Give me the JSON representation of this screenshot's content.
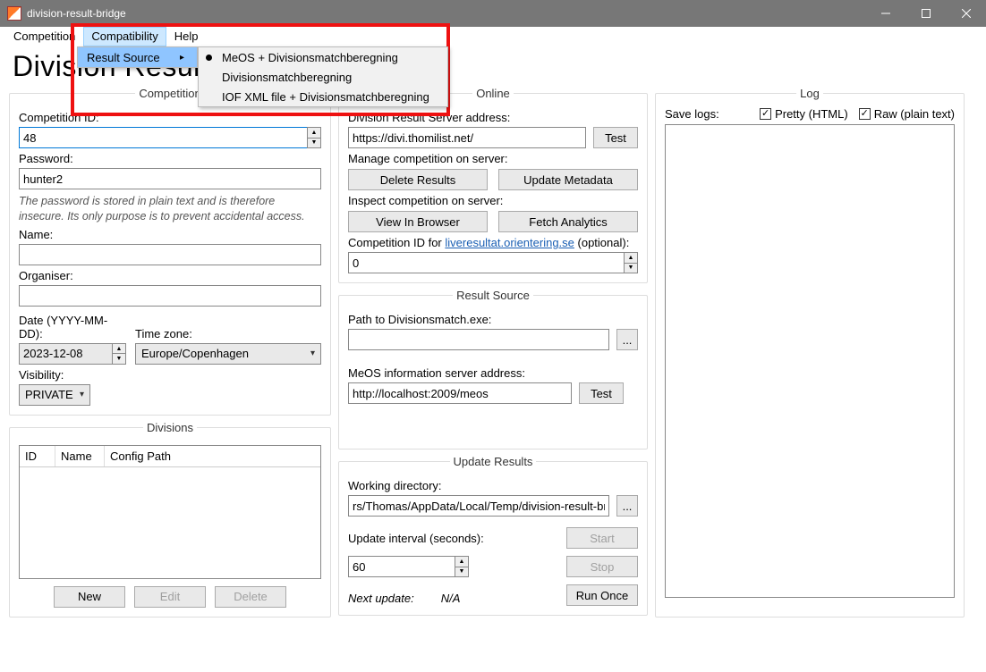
{
  "window": {
    "title": "division-result-bridge"
  },
  "menubar": {
    "items": [
      "Competition",
      "Compatibility",
      "Help"
    ],
    "highlighted_index": 1
  },
  "menu": {
    "item": "Result Source",
    "options": [
      "MeOS + Divisionsmatchberegning",
      "Divisionsmatchberegning",
      "IOF XML file + Divisionsmatchberegning"
    ],
    "selected_index": 0
  },
  "page_title": "Division Result Bridge",
  "competition": {
    "legend": "Competition",
    "id_label": "Competition ID:",
    "id_value": "48",
    "password_label": "Password:",
    "password_value": "hunter2",
    "password_note": "The password is stored in plain text and is therefore insecure. Its only purpose is to prevent accidental access.",
    "name_label": "Name:",
    "name_value": "",
    "organiser_label": "Organiser:",
    "organiser_value": "",
    "date_label": "Date (YYYY-MM-DD):",
    "date_value": "2023-12-08",
    "tz_label": "Time zone:",
    "tz_value": "Europe/Copenhagen",
    "visibility_label": "Visibility:",
    "visibility_value": "PRIVATE"
  },
  "divisions": {
    "legend": "Divisions",
    "columns": [
      "ID",
      "Name",
      "Config Path"
    ],
    "rows": [],
    "new_btn": "New",
    "edit_btn": "Edit",
    "delete_btn": "Delete"
  },
  "online": {
    "legend": "Online",
    "server_label": "Division Result Server address:",
    "server_value": "https://divi.thomilist.net/",
    "test_btn": "Test",
    "manage_label": "Manage competition on server:",
    "delete_results_btn": "Delete Results",
    "update_metadata_btn": "Update Metadata",
    "inspect_label": "Inspect competition on server:",
    "view_browser_btn": "View In Browser",
    "fetch_analytics_btn": "Fetch Analytics",
    "live_pre": "Competition ID for ",
    "live_link": "liveresultat.orientering.se",
    "live_post": " (optional):",
    "live_value": "0"
  },
  "result_source": {
    "legend": "Result Source",
    "dm_label": "Path to Divisionsmatch.exe:",
    "dm_value": "",
    "browse_btn": "...",
    "meos_label": "MeOS information server address:",
    "meos_value": "http://localhost:2009/meos",
    "test_btn": "Test"
  },
  "update": {
    "legend": "Update Results",
    "wd_label": "Working directory:",
    "wd_value": "rs/Thomas/AppData/Local/Temp/division-result-bridge",
    "browse_btn": "...",
    "interval_label": "Update interval (seconds):",
    "interval_value": "60",
    "start_btn": "Start",
    "stop_btn": "Stop",
    "run_once_btn": "Run Once",
    "next_label": "Next update:",
    "next_value": "N/A"
  },
  "log": {
    "legend": "Log",
    "save_label": "Save logs:",
    "pretty_label": "Pretty (HTML)",
    "raw_label": "Raw (plain text)"
  }
}
